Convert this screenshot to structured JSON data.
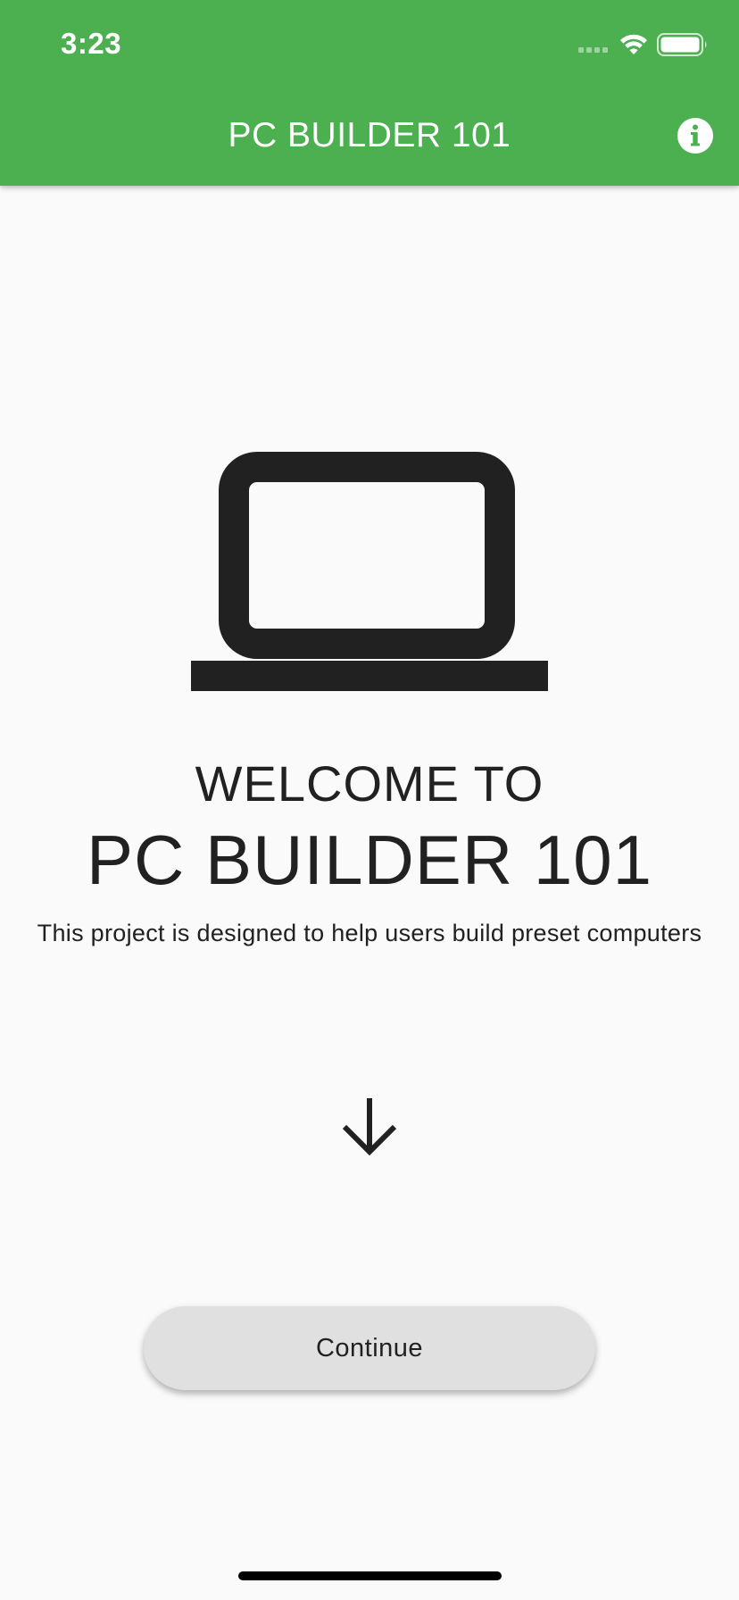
{
  "status_bar": {
    "time": "3:23",
    "icons": [
      "cellular-signal-icon",
      "wifi-icon",
      "battery-icon"
    ]
  },
  "app_bar": {
    "title": "PC BUILDER 101",
    "action_icon": "info-icon",
    "background_color": "#4caf50"
  },
  "hero": {
    "icon": "laptop-icon"
  },
  "welcome": {
    "line1": "WELCOME TO",
    "line2": "PC BUILDER 101",
    "description": "This project is designed to help users build preset computers"
  },
  "indicator": {
    "icon": "arrow-down-icon"
  },
  "actions": {
    "continue_label": "Continue"
  }
}
